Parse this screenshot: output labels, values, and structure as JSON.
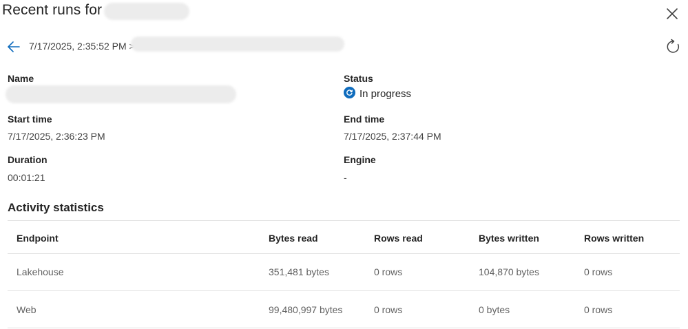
{
  "panel": {
    "title": "Recent runs for",
    "close_icon": "close-icon"
  },
  "breadcrumb": {
    "back_icon": "arrow-left-icon",
    "run_time": "7/17/2025, 2:35:52 PM >",
    "refresh_icon": "refresh-icon"
  },
  "details": {
    "name_label": "Name",
    "status_label": "Status",
    "status_value": "In progress",
    "status_icon": "in-progress-icon",
    "start_label": "Start time",
    "start_value": "7/17/2025, 2:36:23 PM",
    "end_label": "End time",
    "end_value": "7/17/2025, 2:37:44 PM",
    "duration_label": "Duration",
    "duration_value": "00:01:21",
    "engine_label": "Engine",
    "engine_value": "-"
  },
  "activity": {
    "title": "Activity statistics",
    "columns": [
      "Endpoint",
      "Bytes read",
      "Rows read",
      "Bytes written",
      "Rows written"
    ],
    "rows": [
      [
        "Lakehouse",
        "351,481 bytes",
        "0 rows",
        "104,870 bytes",
        "0 rows"
      ],
      [
        "Web",
        "99,480,997 bytes",
        "0 rows",
        "0 bytes",
        "0 rows"
      ]
    ]
  },
  "colors": {
    "accent": "#0f6cbd",
    "text": "#242424",
    "muted": "#616161",
    "divider": "#e1e1e1"
  }
}
